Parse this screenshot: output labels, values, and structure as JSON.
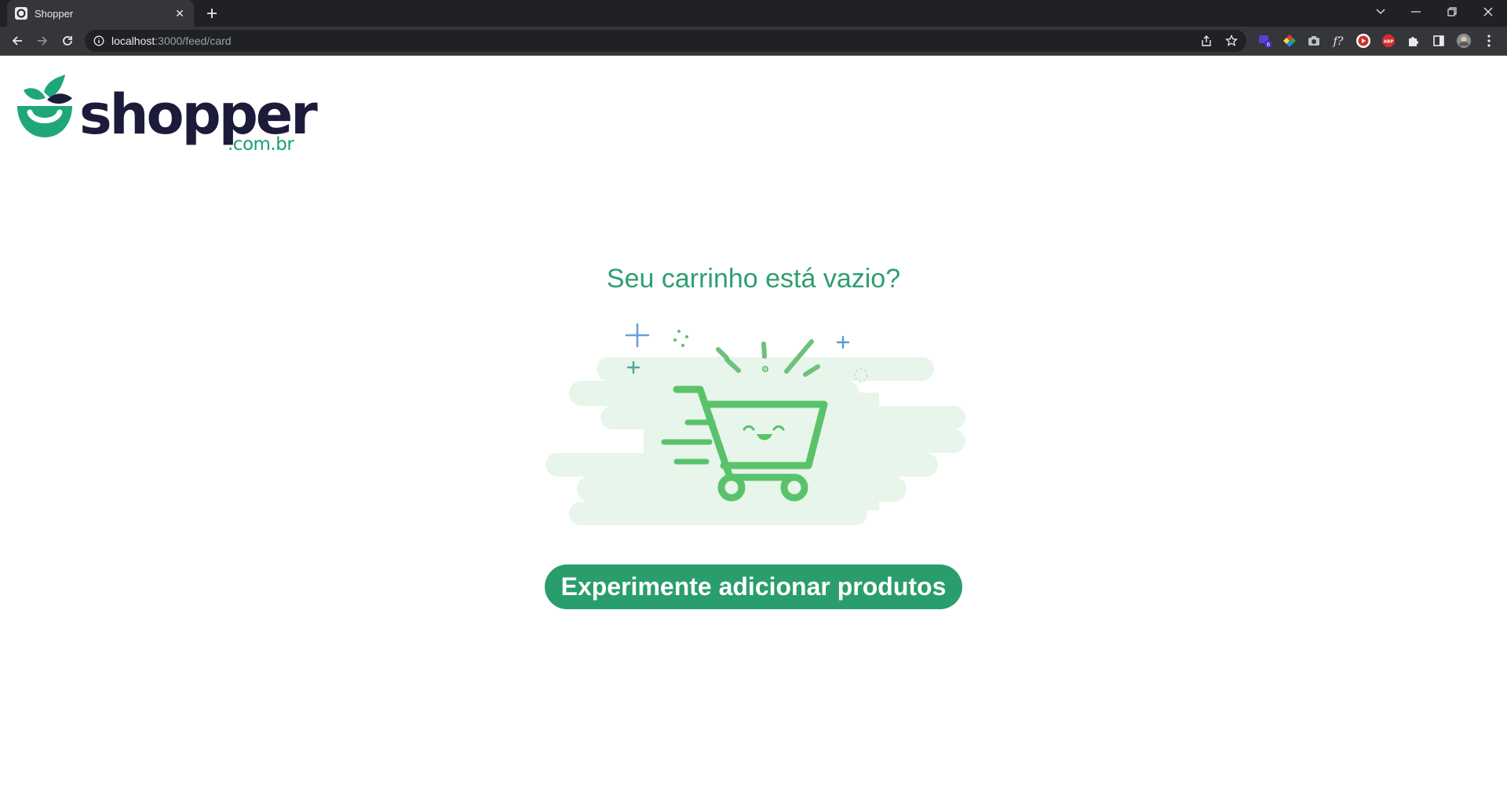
{
  "browser": {
    "tab": {
      "title": "Shopper",
      "close_glyph": "✕"
    },
    "new_tab_glyph": "+",
    "url_host": "localhost",
    "url_path": ":3000/feed/card",
    "window_controls": {
      "dropdown": "⌵",
      "minimize": "–",
      "restore": "❐",
      "close": "✕"
    }
  },
  "logo": {
    "wordmark": "shopper",
    "domain": ".com.br",
    "colors": {
      "primary": "#1d1b3a",
      "accent": "#16a172"
    }
  },
  "empty_cart": {
    "title": "Seu carrinho está vazio?",
    "cta_label": "Experimente adicionar produtos",
    "colors": {
      "title": "#2e9e72",
      "cta_bg": "#2a9d6c",
      "cart": "#5ac26b",
      "cloud": "#e8f5ea"
    }
  }
}
